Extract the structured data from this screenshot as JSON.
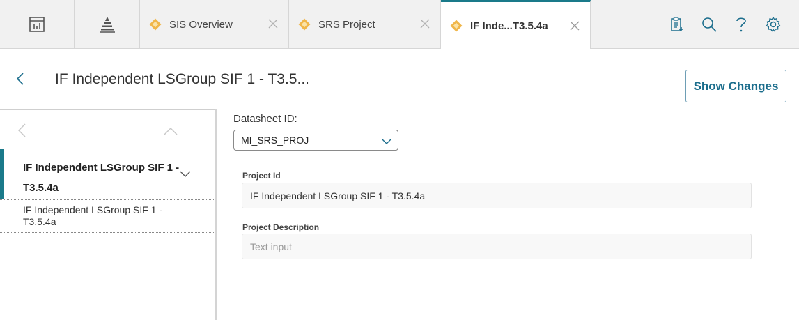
{
  "tabs": [
    {
      "type": "icon",
      "icon": "dashboard-icon"
    },
    {
      "type": "icon",
      "icon": "hierarchy-icon"
    },
    {
      "type": "doc",
      "label": "SIS Overview",
      "icon": "diamond-icon",
      "active": false
    },
    {
      "type": "doc",
      "label": "SRS Project",
      "icon": "diamond-icon",
      "active": false
    },
    {
      "type": "doc",
      "label": "IF Inde...T3.5.4a",
      "icon": "diamond-icon",
      "active": true
    }
  ],
  "toolbar": {
    "icons": [
      "clipboard-add-icon",
      "search-icon",
      "help-icon",
      "settings-icon"
    ]
  },
  "header": {
    "title": "IF Independent LSGroup SIF 1 - T3.5...",
    "show_changes_label": "Show Changes"
  },
  "left_panel": {
    "active_item": {
      "title": "IF Independent LSGroup SIF 1 - T3.5.4a"
    },
    "child_item": {
      "title": "IF Independent LSGroup SIF 1 - T3.5.4a"
    }
  },
  "datasheet": {
    "label": "Datasheet ID:",
    "selected": "MI_SRS_PROJ"
  },
  "fields": {
    "project_id": {
      "label": "Project Id",
      "value": "IF Independent LSGroup SIF 1 - T3.5.4a"
    },
    "project_description": {
      "label": "Project Description",
      "value": "",
      "placeholder": "Text input"
    }
  },
  "colors": {
    "accent": "#1a7a8a",
    "tab_diamond": "#f0b64a",
    "button_text": "#1b6d8c",
    "tab_bar_bg": "#f1f1f1"
  }
}
